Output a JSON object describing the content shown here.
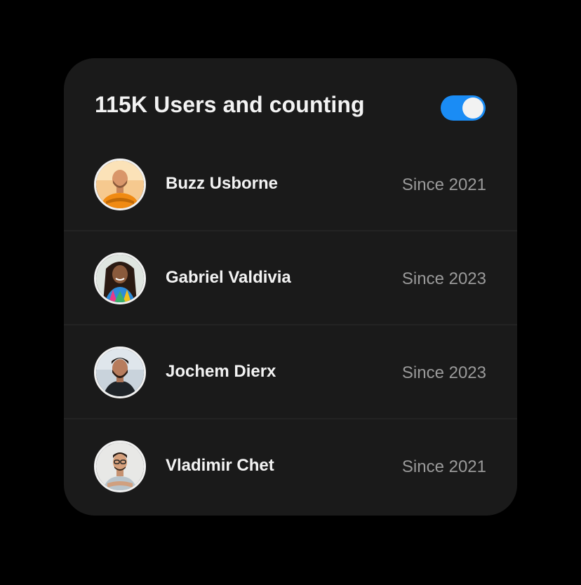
{
  "card": {
    "title": "115K Users and counting",
    "toggle_on": true,
    "accent_color": "#1a8cf5"
  },
  "users": [
    {
      "name": "Buzz Usborne",
      "since": "Since 2021",
      "avatar_icon": "avatar-photo-orange-shirt"
    },
    {
      "name": "Gabriel Valdivia",
      "since": "Since 2023",
      "avatar_icon": "avatar-photo-colorful-top"
    },
    {
      "name": "Jochem Dierx",
      "since": "Since 2023",
      "avatar_icon": "avatar-photo-dark-shirt"
    },
    {
      "name": "Vladimir Chet",
      "since": "Since 2021",
      "avatar_icon": "avatar-photo-grey-shirt"
    }
  ]
}
